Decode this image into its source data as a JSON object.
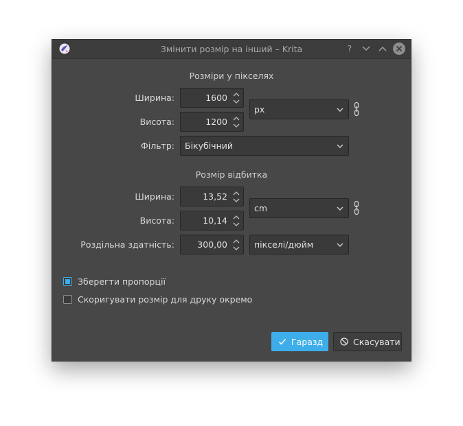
{
  "window": {
    "title": "Змінити розмір на інший – Krita",
    "help_glyph": "?",
    "buttons": [
      "help",
      "minimize",
      "maximize",
      "close"
    ]
  },
  "pixel_dimensions": {
    "heading": "Розміри у пікселях",
    "width_label": "Ширина:",
    "width_value": "1600",
    "height_label": "Висота:",
    "height_value": "1200",
    "unit": "px",
    "filter_label": "Фільтр:",
    "filter_value": "Бікубічний"
  },
  "print_size": {
    "heading": "Розмір відбитка",
    "width_label": "Ширина:",
    "width_value": "13,52",
    "height_label": "Висота:",
    "height_value": "10,14",
    "unit": "cm",
    "resolution_label": "Роздільна здатність:",
    "resolution_value": "300,00",
    "resolution_unit": "пікселі/дюйм"
  },
  "options": {
    "keep_ratio_label": "Зберегти пропорції",
    "keep_ratio_checked": true,
    "adjust_print_label": "Скоригувати розмір для друку окремо",
    "adjust_print_checked": false
  },
  "footer": {
    "ok_label": "Гаразд",
    "cancel_label": "Скасувати"
  },
  "colors": {
    "accent": "#3daee9",
    "background": "#474747",
    "field": "#3a3a3a"
  }
}
